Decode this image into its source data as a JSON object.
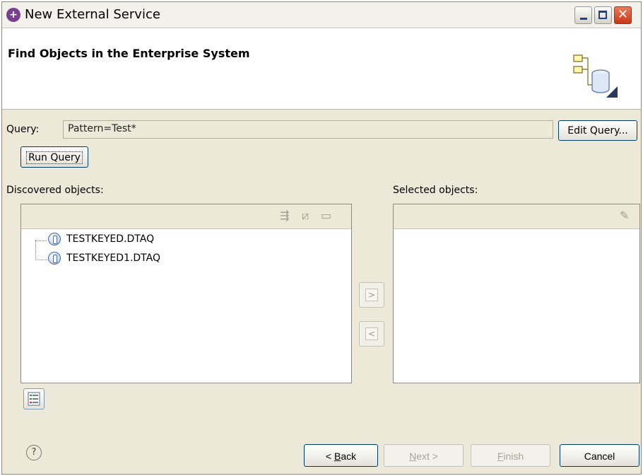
{
  "window": {
    "title": "New External Service",
    "app_icon": "wizard-app-icon",
    "controls": [
      "minimize-icon",
      "maximize-icon",
      "close-icon"
    ]
  },
  "header": {
    "title": "Find Objects in the Enterprise System",
    "banner_icon": "enterprise-system-icon"
  },
  "query": {
    "label": "Query:",
    "value": "Pattern=Test*",
    "edit_button": "Edit Query...",
    "run_button": "Run Query"
  },
  "discovered": {
    "label": "Discovered objects:",
    "toolbar_icons": [
      "filter-icon",
      "edit-icon",
      "book-icon"
    ],
    "items": [
      {
        "label": "TESTKEYED.DTAQ",
        "icon": "data-queue-icon"
      },
      {
        "label": "TESTKEYED1.DTAQ",
        "icon": "data-queue-icon"
      }
    ]
  },
  "selected": {
    "label": "Selected objects:",
    "toolbar_icons": [
      "edit-icon"
    ],
    "items": []
  },
  "transfer": {
    "add_label": ">",
    "remove_label": "<"
  },
  "footer": {
    "help_label": "?",
    "back_label": "Back",
    "back_prefix": "< ",
    "back_mnemonic": "B",
    "back_rest": "ack",
    "next_label": "Next >",
    "next_mnemonic": "N",
    "next_rest": "ext >",
    "finish_label": "Finish",
    "finish_mnemonic": "F",
    "finish_rest": "inish",
    "cancel_label": "Cancel"
  },
  "colors": {
    "dialog_bg": "#ece9d8",
    "panel_bg": "#ffffff",
    "button_border": "#003c74",
    "close_button": "#c9381a",
    "app_icon": "#7a3f8f"
  }
}
